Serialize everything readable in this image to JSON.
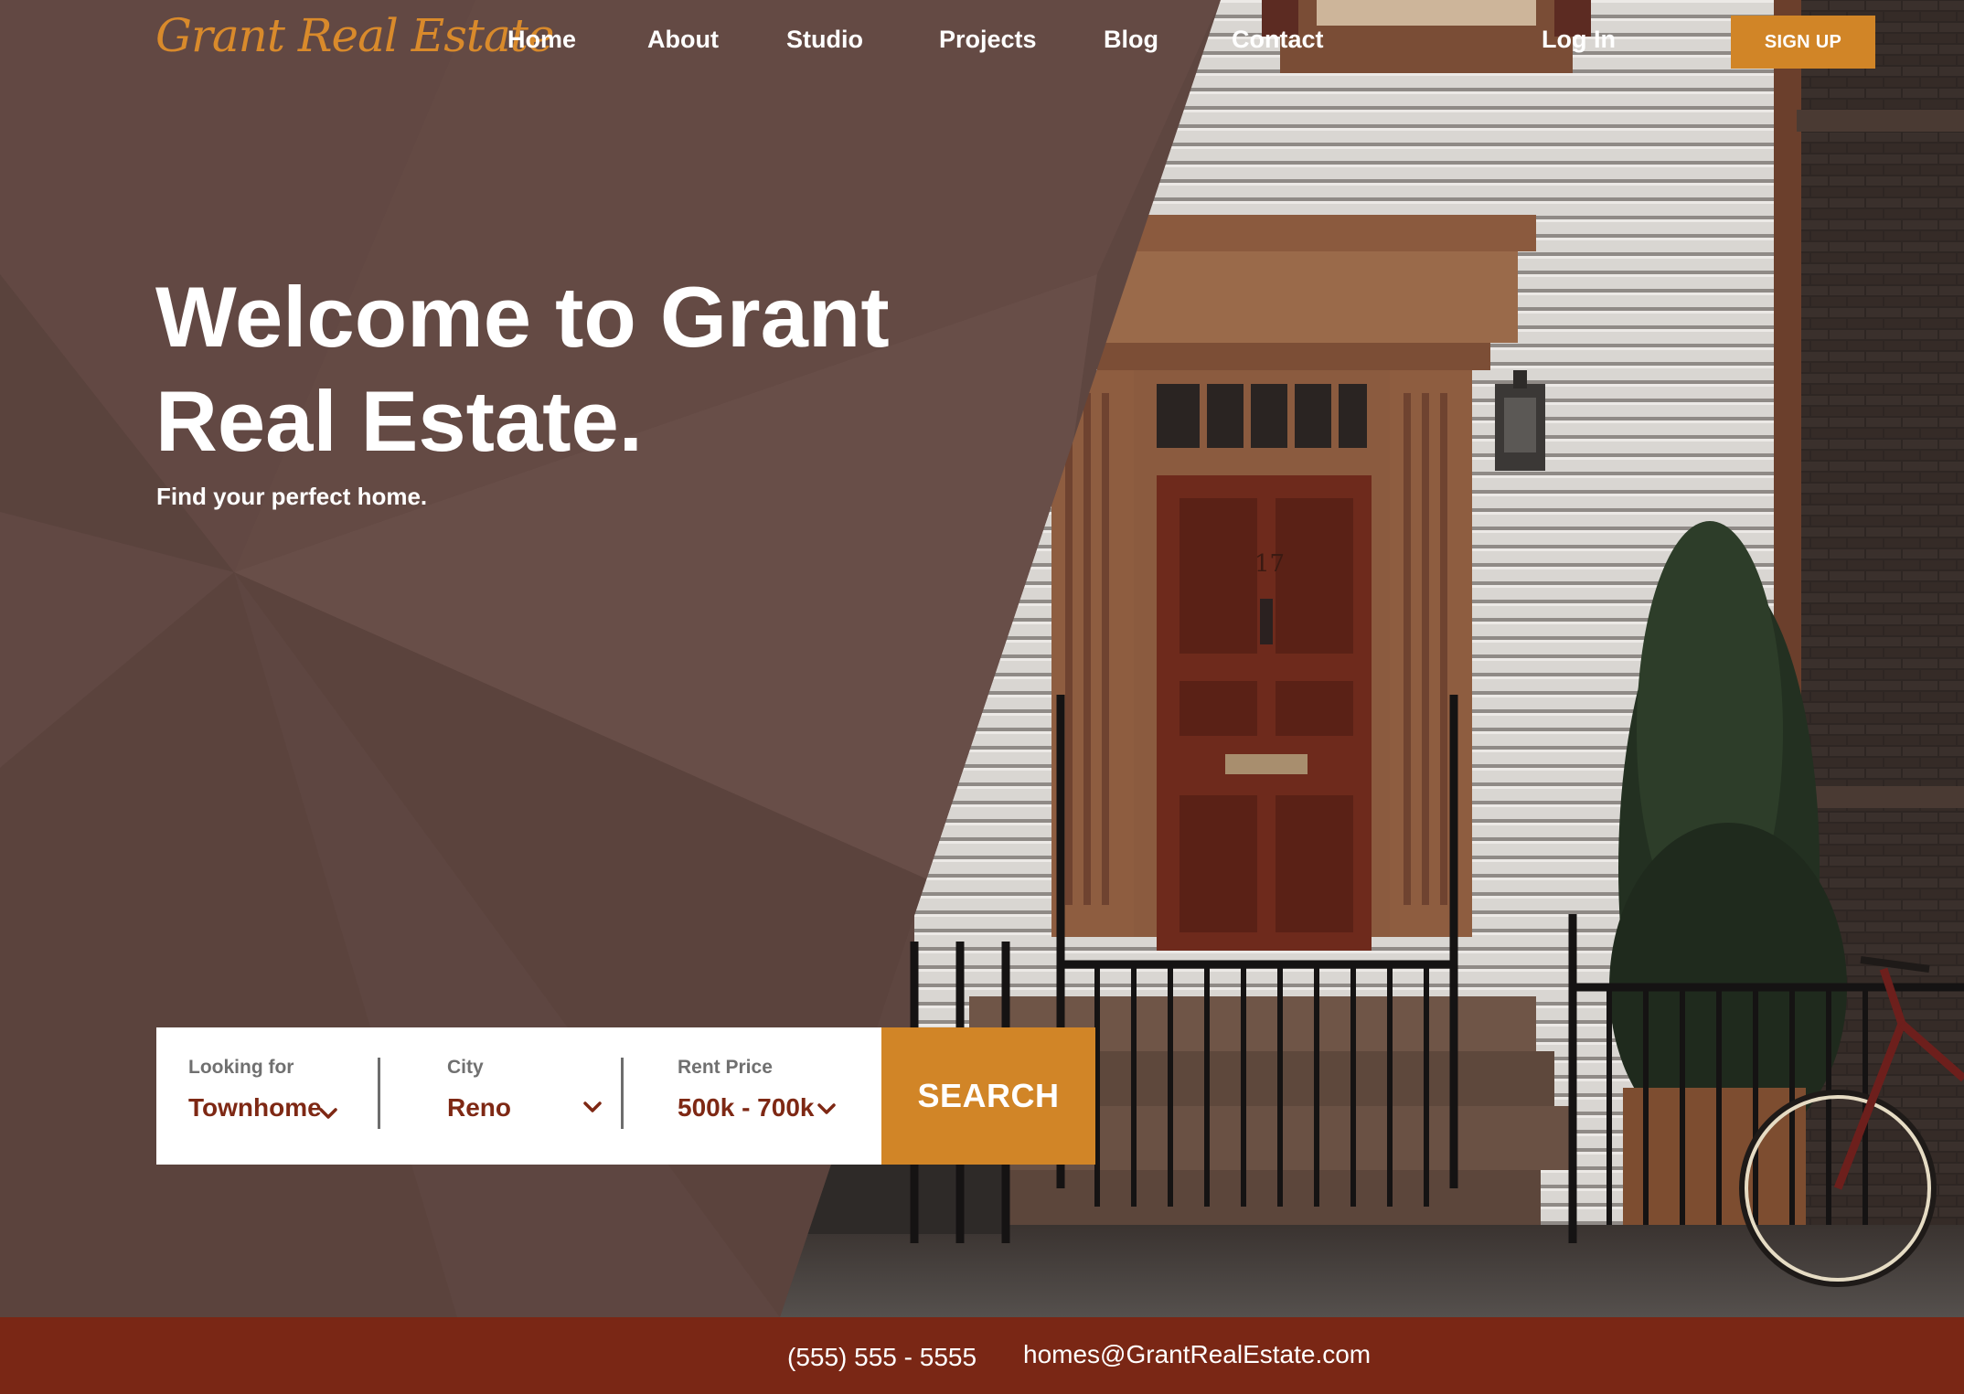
{
  "brand": {
    "logo_text": "Grant Real Estate",
    "accent_color": "#d18527",
    "footer_color": "#7a2715",
    "panel_color": "#5e4640"
  },
  "nav": {
    "items": [
      {
        "label": "Home"
      },
      {
        "label": "About"
      },
      {
        "label": "Studio"
      },
      {
        "label": "Projects"
      },
      {
        "label": "Blog"
      },
      {
        "label": "Contact"
      }
    ],
    "login_label": "Log In",
    "signup_label": "SIGN UP"
  },
  "hero": {
    "title": "Welcome to Grant Real Estate.",
    "subtitle": "Find your perfect home."
  },
  "search": {
    "looking_for": {
      "label": "Looking for",
      "value": "Townhome",
      "icon": "chevron-down-icon"
    },
    "city": {
      "label": "City",
      "value": "Reno",
      "icon": "chevron-down-icon"
    },
    "rent_price": {
      "label": "Rent Price",
      "value": "500k - 700k",
      "icon": "chevron-down-icon"
    },
    "button_label": "SEARCH"
  },
  "footer": {
    "phone": "(555) 555 - 5555",
    "email": "homes@GrantRealEstate.com"
  },
  "photo": {
    "house_number": "17"
  }
}
